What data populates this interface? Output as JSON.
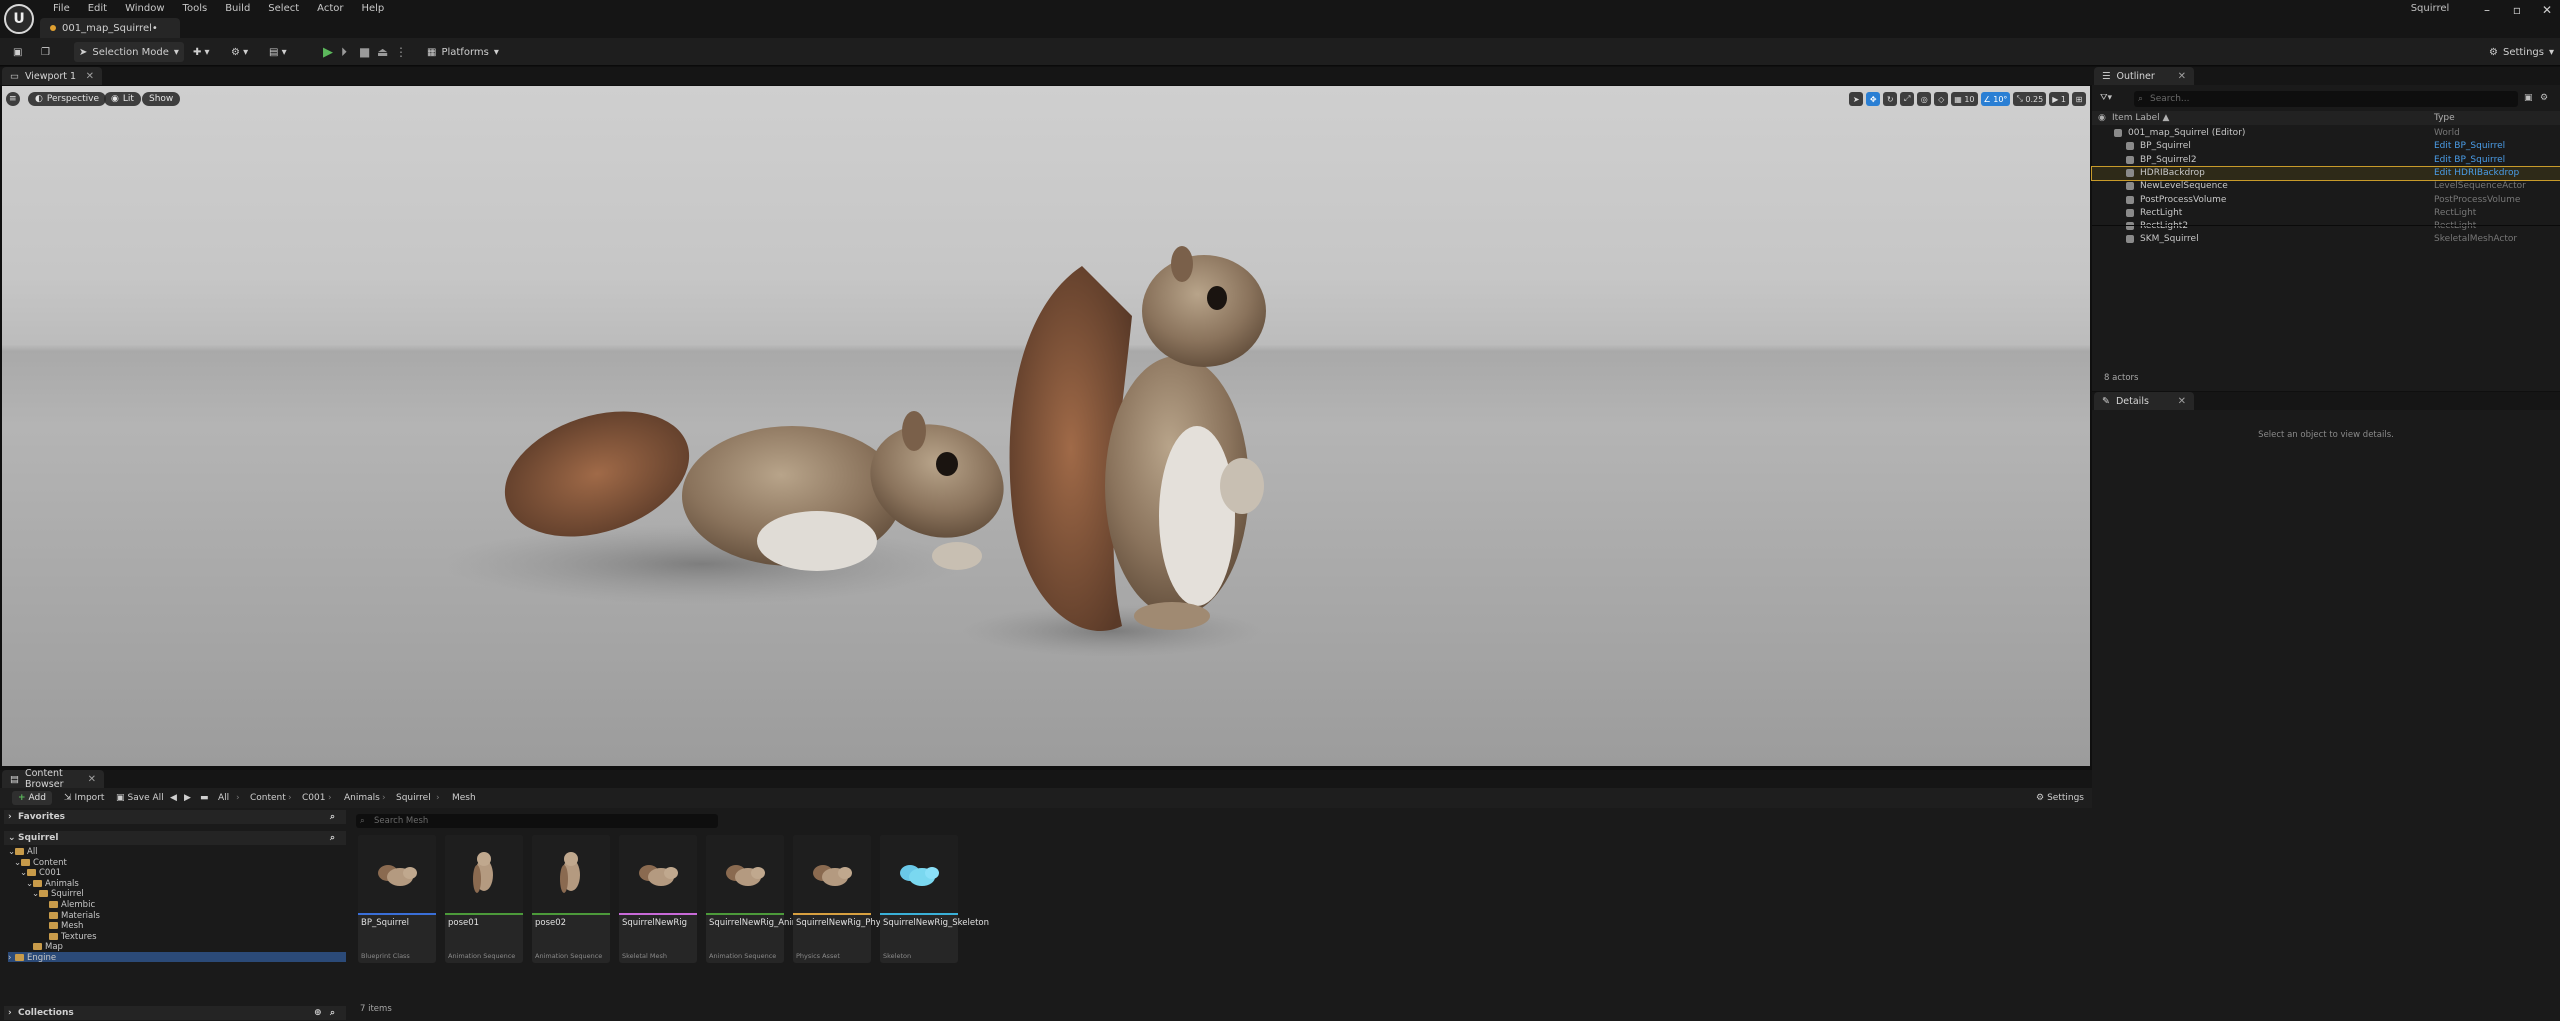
{
  "app": {
    "project_name": "Squirrel",
    "map_tab": "001_map_Squirrel•"
  },
  "menu": [
    "File",
    "Edit",
    "Window",
    "Tools",
    "Build",
    "Select",
    "Actor",
    "Help"
  ],
  "toolbar": {
    "selection_mode": "Selection Mode",
    "platforms": "Platforms",
    "settings": "Settings"
  },
  "viewport": {
    "tab": "Viewport 1",
    "perspective": "Perspective",
    "lit": "Lit",
    "show": "Show",
    "grid_snap": "10",
    "rotation_snap": "10°",
    "scale_snap": "0.25",
    "camera_speed": "1"
  },
  "outliner": {
    "tab": "Outliner",
    "search_placeholder": "Search...",
    "col_label": "Item Label ▲",
    "col_type": "Type",
    "rows": [
      {
        "label": "001_map_Squirrel (Editor)",
        "type": "World",
        "link": false
      },
      {
        "label": "BP_Squirrel",
        "type": "Edit BP_Squirrel",
        "link": true
      },
      {
        "label": "BP_Squirrel2",
        "type": "Edit BP_Squirrel",
        "link": true
      },
      {
        "label": "HDRIBackdrop",
        "type": "Edit HDRIBackdrop",
        "link": true
      },
      {
        "label": "NewLevelSequence",
        "type": "LevelSequenceActor",
        "link": false
      },
      {
        "label": "PostProcessVolume",
        "type": "PostProcessVolume",
        "link": false
      },
      {
        "label": "RectLight",
        "type": "RectLight",
        "link": false
      },
      {
        "label": "RectLight2",
        "type": "RectLight",
        "link": false
      },
      {
        "label": "SKM_Squirrel",
        "type": "SkeletalMeshActor",
        "link": false
      }
    ],
    "actor_count": "8 actors"
  },
  "details": {
    "tab": "Details",
    "empty_text": "Select an object to view details."
  },
  "content_browser": {
    "tab": "Content Browser",
    "add": "Add",
    "import": "Import",
    "save_all": "Save All",
    "breadcrumb": [
      "All",
      "Content",
      "C001",
      "Animals",
      "Squirrel",
      "Mesh"
    ],
    "settings": "Settings",
    "favorites": "Favorites",
    "squirrel_section": "Squirrel",
    "collections": "Collections",
    "search_placeholder": "Search Mesh",
    "tree": [
      "All",
      "Content",
      "C001",
      "Animals",
      "Squirrel",
      "Alembic",
      "Materials",
      "Mesh",
      "Textures",
      "Map",
      "Engine"
    ],
    "assets": [
      {
        "name": "BP_Squirrel",
        "kind": "Blueprint Class",
        "color": "#3a6fd8"
      },
      {
        "name": "pose01",
        "kind": "Animation Sequence",
        "color": "#4c9a3a"
      },
      {
        "name": "pose02",
        "kind": "Animation Sequence",
        "color": "#4c9a3a"
      },
      {
        "name": "SquirrelNewRig",
        "kind": "Skeletal Mesh",
        "color": "#c86ad8"
      },
      {
        "name": "SquirrelNewRig_Anim",
        "kind": "Animation Sequence",
        "color": "#4c9a3a"
      },
      {
        "name": "SquirrelNewRig_PhysicsAsset",
        "kind": "Physics Asset",
        "color": "#d8a040"
      },
      {
        "name": "SquirrelNewRig_Skeleton",
        "kind": "Skeleton",
        "color": "#3ab0d8"
      }
    ],
    "item_count": "7 items"
  }
}
